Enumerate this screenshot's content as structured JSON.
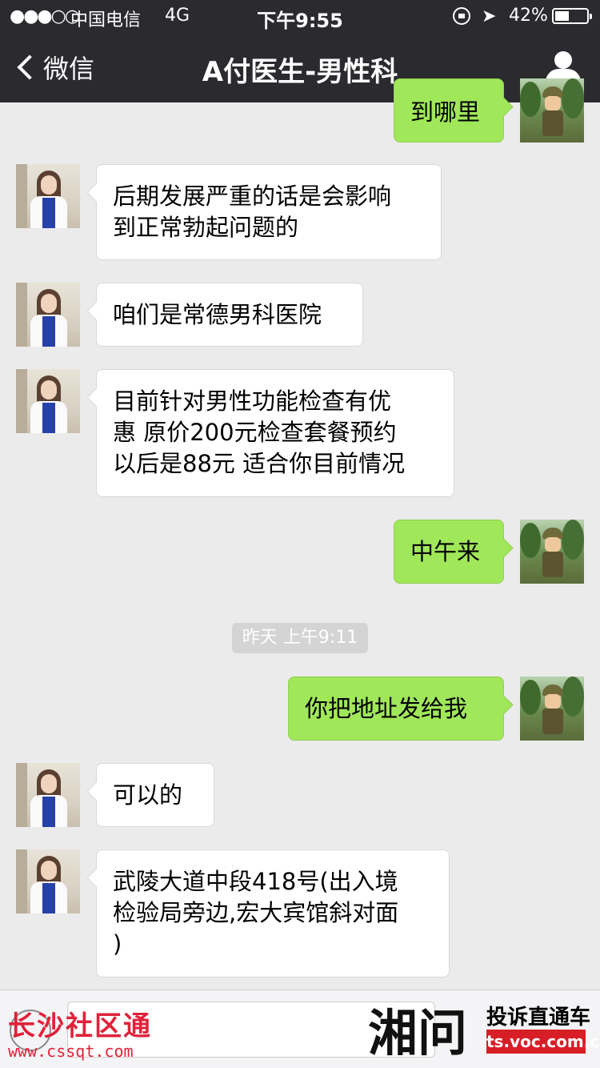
{
  "status_bar": {
    "signal": "●●●○○",
    "carrier": "中国电信",
    "network": "4G",
    "time": "下午9:55",
    "battery": "42%"
  },
  "nav": {
    "back_label": "微信",
    "title": "A付医生-男性科"
  },
  "messages": [
    {
      "side": "right",
      "lines": [
        "到哪里"
      ]
    },
    {
      "side": "left",
      "lines": [
        "后期发展严重的话是会影响",
        "到正常勃起问题的"
      ]
    },
    {
      "side": "left",
      "lines": [
        "咱们是常德男科医院"
      ]
    },
    {
      "side": "left",
      "lines": [
        "目前针对男性功能检查有优",
        "惠 原价200元检查套餐预约",
        "以后是88元 适合你目前情况"
      ]
    },
    {
      "side": "right",
      "lines": [
        "中午来"
      ]
    },
    {
      "side": "right",
      "lines": [
        "你把地址发给我"
      ]
    },
    {
      "side": "left",
      "lines": [
        "可以的"
      ]
    },
    {
      "side": "left",
      "lines": [
        "武陵大道中段418号(出入境",
        "检验局旁边,宏大宾馆斜对面",
        ")"
      ]
    }
  ],
  "timestamp": "昨天 上午9:11",
  "watermarks": {
    "left_cn": "长沙社区通",
    "left_url": "www.cssqt.com",
    "right_logo": "湘问",
    "right_cn": "投诉直通车",
    "right_url": "ts.voc.com.cn"
  }
}
